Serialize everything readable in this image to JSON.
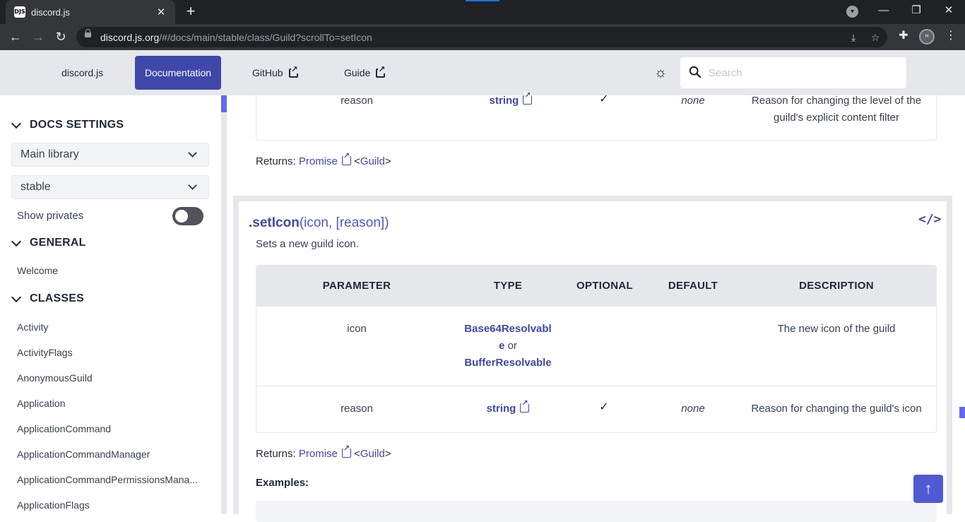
{
  "browser": {
    "tab_title": "discord.js",
    "favicon_text": "DJS",
    "url_host": "discord.js.org",
    "url_path": "/#/docs/main/stable/class/Guild?scrollTo=setIcon",
    "profile_initials": "H"
  },
  "header": {
    "nav": [
      "discord.js",
      "Documentation",
      "GitHub",
      "Guide"
    ],
    "active_nav": "Documentation",
    "search_placeholder": "Search"
  },
  "sidebar": {
    "docs_settings": "DOCS SETTINGS",
    "library_select": "Main library",
    "version_select": "stable",
    "show_privates": "Show privates",
    "show_privates_on": false,
    "general": "GENERAL",
    "general_items": [
      "Welcome"
    ],
    "classes": "CLASSES",
    "class_items": [
      "Activity",
      "ActivityFlags",
      "AnonymousGuild",
      "Application",
      "ApplicationCommand",
      "ApplicationCommandManager",
      "ApplicationCommandPermissionsMana...",
      "ApplicationFlags"
    ]
  },
  "prev_method": {
    "row": {
      "parameter": "reason",
      "type": "string",
      "optional": "✓",
      "default": "none",
      "description_line1": "Reason for changing the level of the",
      "description_line2": "guild's explicit content filter"
    },
    "returns_label": "Returns:",
    "returns_type": "Promise",
    "returns_generic": "<Guild>"
  },
  "method": {
    "name": ".setIcon",
    "params": "(icon, [reason])",
    "description": "Sets a new guild icon.",
    "columns": [
      "PARAMETER",
      "TYPE",
      "OPTIONAL",
      "DEFAULT",
      "DESCRIPTION"
    ],
    "rows": [
      {
        "parameter": "icon",
        "type_line1": "Base64Resolvabl",
        "type_line2": "e",
        "type_or": "or",
        "type_line3": "BufferResolvable",
        "optional": "",
        "default": "",
        "description": "The new icon of the guild"
      },
      {
        "parameter": "reason",
        "type": "string",
        "optional": "✓",
        "default": "none",
        "description": "Reason for changing the guild's icon"
      }
    ],
    "returns_label": "Returns:",
    "returns_type": "Promise",
    "returns_generic": "<Guild>",
    "examples_label": "Examples:"
  },
  "colors": {
    "accent": "#3f48a8",
    "header_bg": "#e5e7eb",
    "scroll_top_button": "#4f5bd5"
  },
  "icons": {
    "theme_toggle": "sun-icon",
    "view_source": "code-icon",
    "scroll_top": "arrow-up-icon",
    "external": "external-link-icon"
  }
}
